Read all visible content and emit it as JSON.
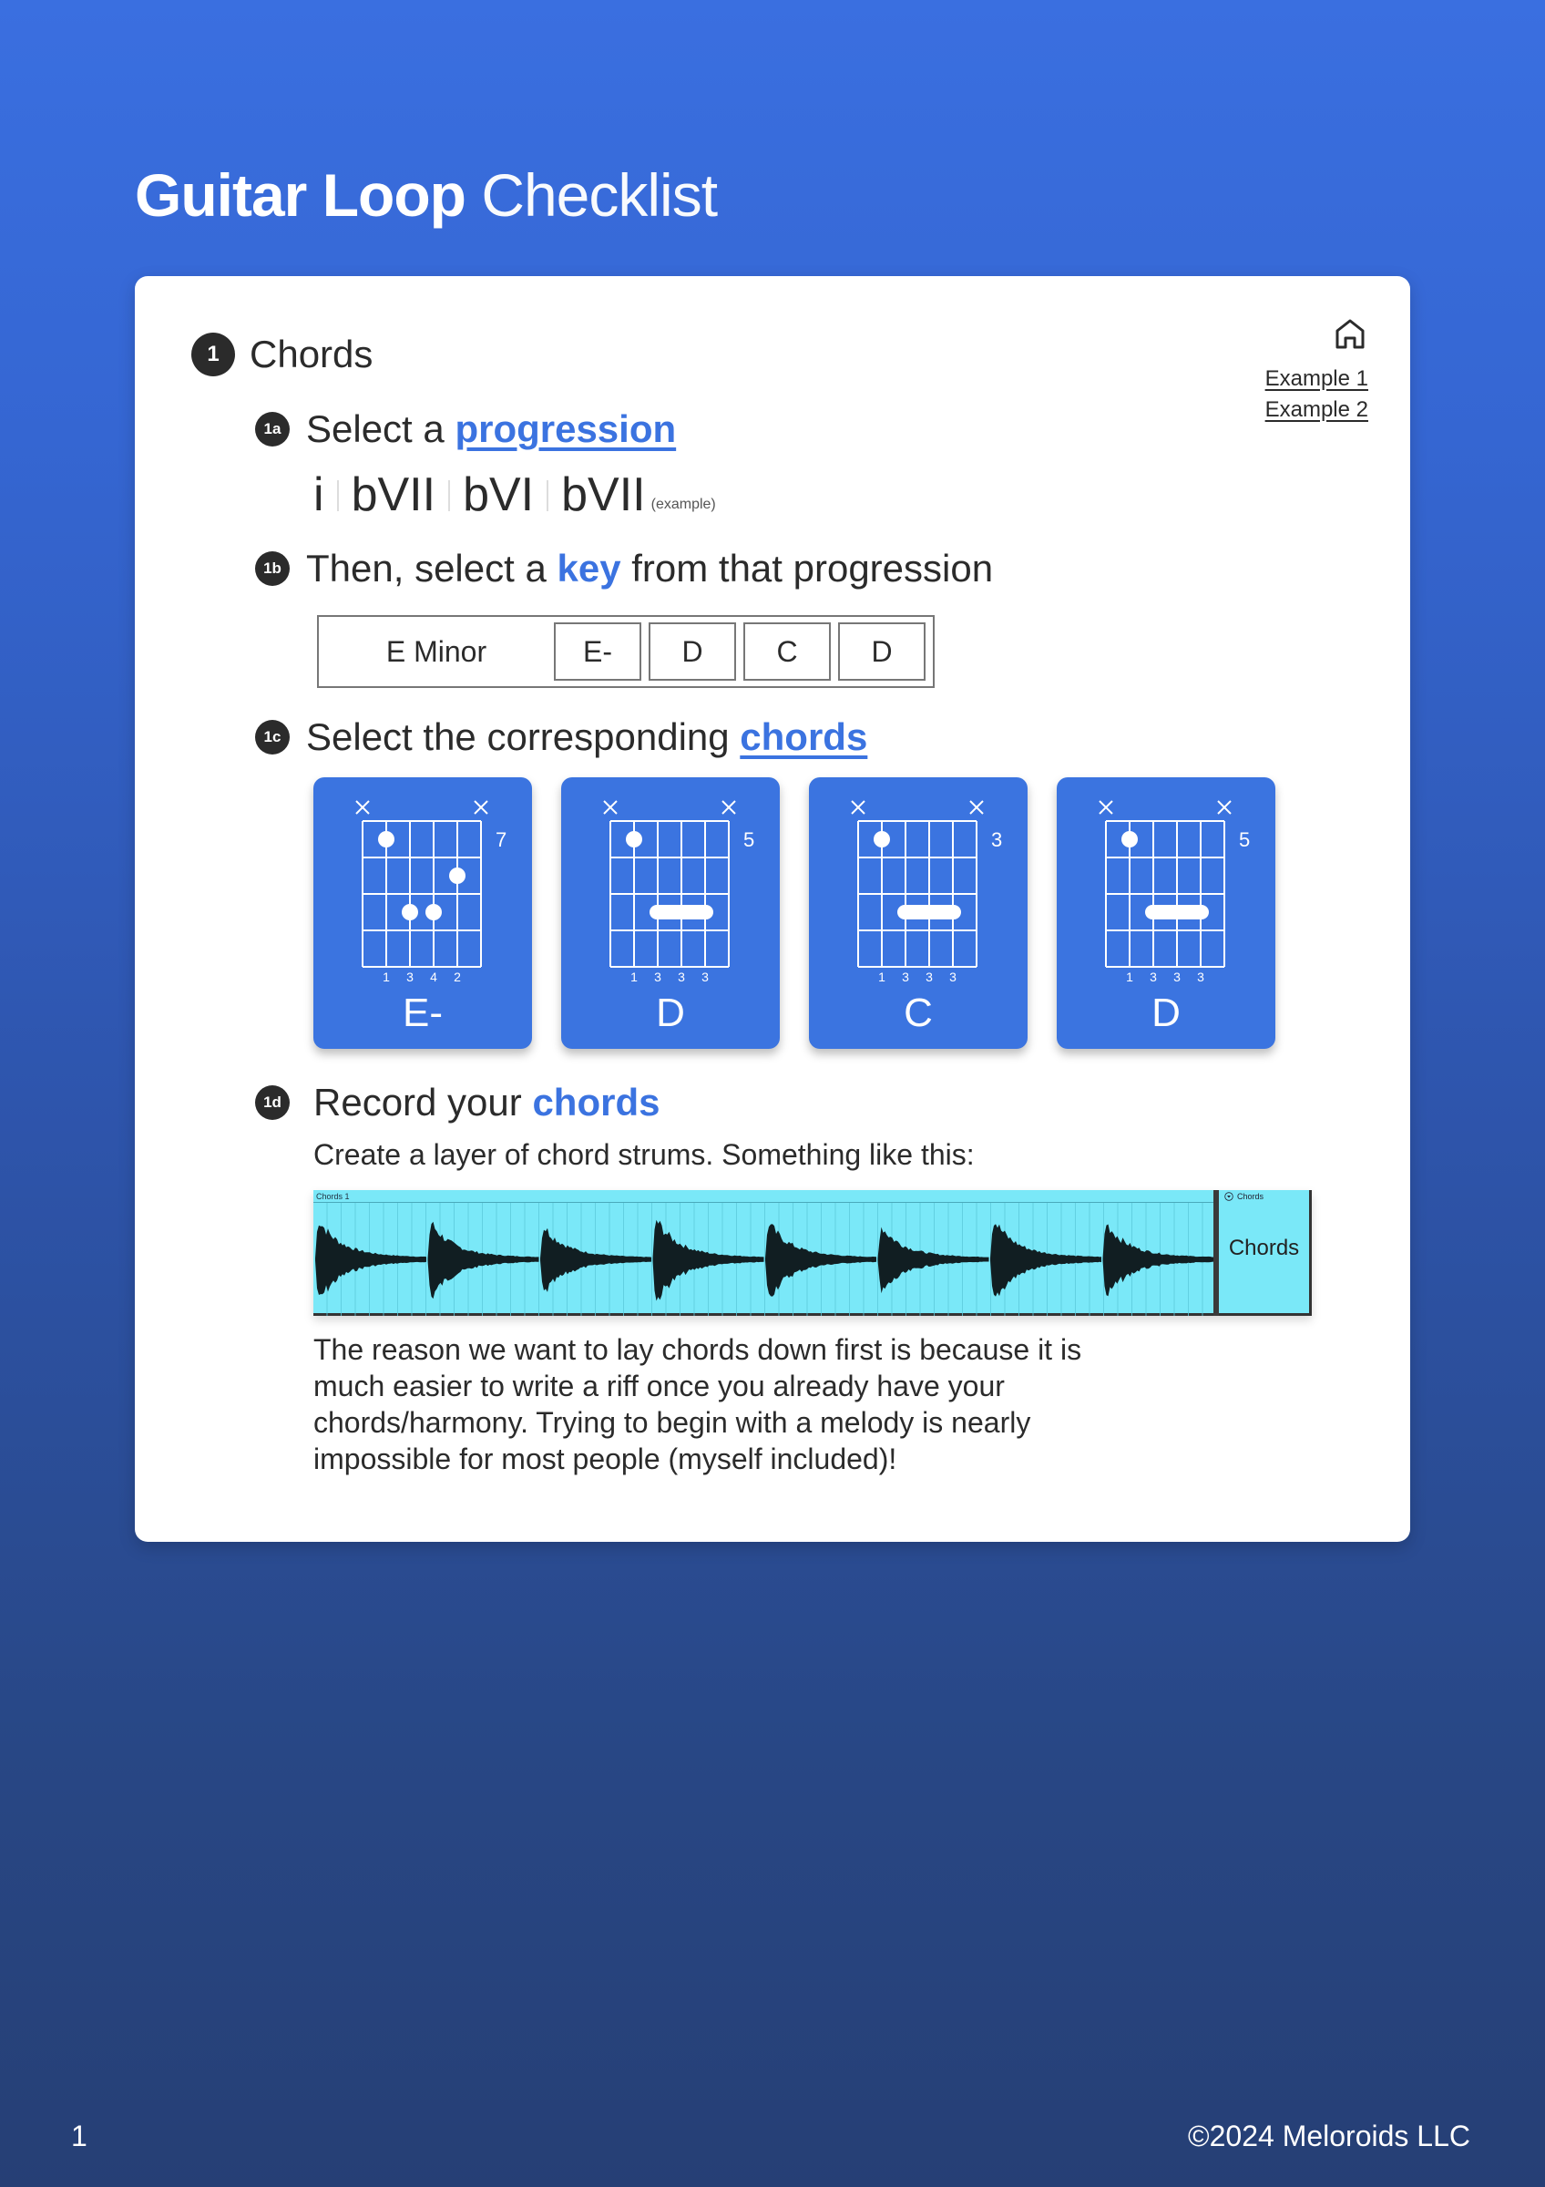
{
  "page": {
    "title_bold": "Guitar Loop",
    "title_light": "Checklist",
    "page_number": "1",
    "copyright": "©2024 Meloroids LLC",
    "colors": {
      "accent": "#3b73e0",
      "background_top": "#3a6fe0",
      "background_bottom": "#263f75",
      "chord_card": "#3b74e0",
      "daw_clip": "#7ae8f8",
      "badge": "#2b2b2b"
    }
  },
  "nav": {
    "home_icon": "home-icon",
    "example1": "Example 1",
    "example2": "Example 2"
  },
  "section": {
    "number": "1",
    "title": "Chords"
  },
  "steps": {
    "s1a": {
      "badge": "1a",
      "prefix": "Select a ",
      "link": "progression"
    },
    "progression": {
      "numerals": [
        "i",
        "bVII",
        "bVI",
        "bVII"
      ],
      "note": "(example)"
    },
    "s1b": {
      "badge": "1b",
      "prefix": "Then, select a ",
      "link": "key",
      "suffix": " from that progression"
    },
    "key": {
      "name": "E Minor",
      "chords": [
        "E-",
        "D",
        "C",
        "D"
      ]
    },
    "s1c": {
      "badge": "1c",
      "prefix": "Select the corresponding ",
      "link": "chords"
    },
    "chord_diagrams": [
      {
        "name": "E-",
        "fret": "7",
        "muted": [
          1,
          6
        ],
        "dots": [
          {
            "string": 2,
            "fret": 1
          },
          {
            "string": 5,
            "fret": 2
          },
          {
            "string": 3,
            "fret": 3
          },
          {
            "string": 4,
            "fret": 3
          }
        ],
        "barre": null,
        "fingers": [
          "1",
          "3",
          "4",
          "2"
        ]
      },
      {
        "name": "D",
        "fret": "5",
        "muted": [
          1,
          6
        ],
        "dots": [
          {
            "string": 2,
            "fret": 1
          }
        ],
        "barre": {
          "from": 3,
          "to": 5,
          "fret": 3
        },
        "fingers": [
          "1",
          "3",
          "3",
          "3"
        ]
      },
      {
        "name": "C",
        "fret": "3",
        "muted": [
          1,
          6
        ],
        "dots": [
          {
            "string": 2,
            "fret": 1
          }
        ],
        "barre": {
          "from": 3,
          "to": 5,
          "fret": 3
        },
        "fingers": [
          "1",
          "3",
          "3",
          "3"
        ]
      },
      {
        "name": "D",
        "fret": "5",
        "muted": [
          1,
          6
        ],
        "dots": [
          {
            "string": 2,
            "fret": 1
          }
        ],
        "barre": {
          "from": 3,
          "to": 5,
          "fret": 3
        },
        "fingers": [
          "1",
          "3",
          "3",
          "3"
        ]
      }
    ],
    "s1d": {
      "badge": "1d",
      "prefix": "Record your ",
      "link": "chords",
      "subtext": "Create a layer of chord strums. Something like this:"
    },
    "daw": {
      "clip_name": "Chords 1",
      "track_small": "Chords",
      "track_label": "Chords",
      "strum_count": 8
    },
    "paragraph": "The reason we want to lay chords down first is because it is much easier to write a riff once you already have your chords/harmony. Trying to begin with a melody is nearly impossible for most people (myself included)!"
  }
}
